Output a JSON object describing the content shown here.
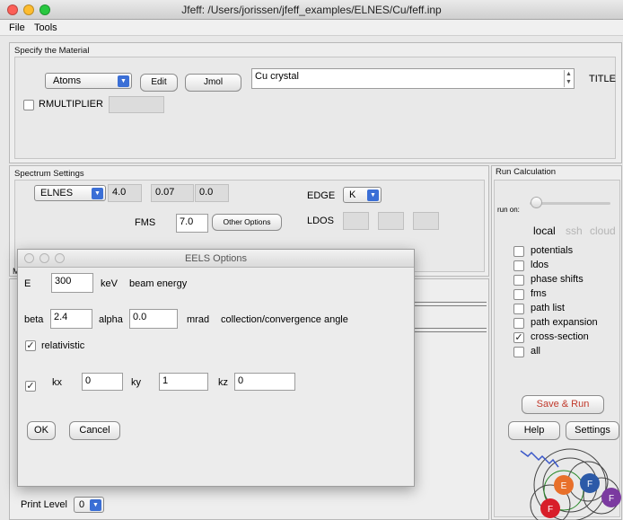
{
  "window": {
    "title": "Jfeff: /Users/jorissen/jfeff_examples/ELNES/Cu/feff.inp"
  },
  "menu": [
    "File",
    "Tools"
  ],
  "material": {
    "section_title": "Specify the Material",
    "atoms_select": "Atoms",
    "edit_label": "Edit",
    "jmol_label": "Jmol",
    "title_value": "Cu crystal",
    "title_label": "TITLE",
    "rmultiplier_label": "RMULTIPLIER"
  },
  "spectrum": {
    "section_title": "Spectrum Settings",
    "type_select": "ELNES",
    "values": [
      "4.0",
      "0.07",
      "0.0"
    ],
    "edge_label": "EDGE",
    "edge_select": "K",
    "fms_label": "FMS",
    "fms_value": "7.0",
    "other_options_label": "Other Options",
    "ldos_label": "LDOS"
  },
  "run": {
    "section_title": "Run Calculation",
    "run_on_label": "run on:",
    "targets": [
      "local",
      "ssh",
      "cloud"
    ],
    "checks": [
      {
        "label": "potentials",
        "checked": false
      },
      {
        "label": "ldos",
        "checked": false
      },
      {
        "label": "phase shifts",
        "checked": false
      },
      {
        "label": "fms",
        "checked": false
      },
      {
        "label": "path list",
        "checked": false
      },
      {
        "label": "path expansion",
        "checked": false
      },
      {
        "label": "cross-section",
        "checked": true
      },
      {
        "label": "all",
        "checked": false
      }
    ],
    "save_run_label": "Save & Run",
    "help_label": "Help",
    "settings_label": "Settings",
    "logo_letters": [
      "E",
      "F",
      "F",
      "F"
    ]
  },
  "print_level": {
    "label": "Print Level",
    "value": "0"
  },
  "eels": {
    "title": "EELS Options",
    "e_label": "E",
    "e_value": "300",
    "e_unit": "keV",
    "e_desc": "beam energy",
    "beta_label": "beta",
    "beta_value": "2.4",
    "alpha_label": "alpha",
    "alpha_value": "0.0",
    "angle_unit": "mrad",
    "angle_desc": "collection/convergence angle",
    "relativistic_label": "relativistic",
    "kx_label": "kx",
    "kx_value": "0",
    "ky_label": "ky",
    "ky_value": "1",
    "kz_label": "kz",
    "kz_value": "0",
    "ok_label": "OK",
    "cancel_label": "Cancel"
  },
  "colors": {
    "accent_red": "#c0392b",
    "select_blue": "#3b6fd6"
  },
  "hidden_letter": "M"
}
